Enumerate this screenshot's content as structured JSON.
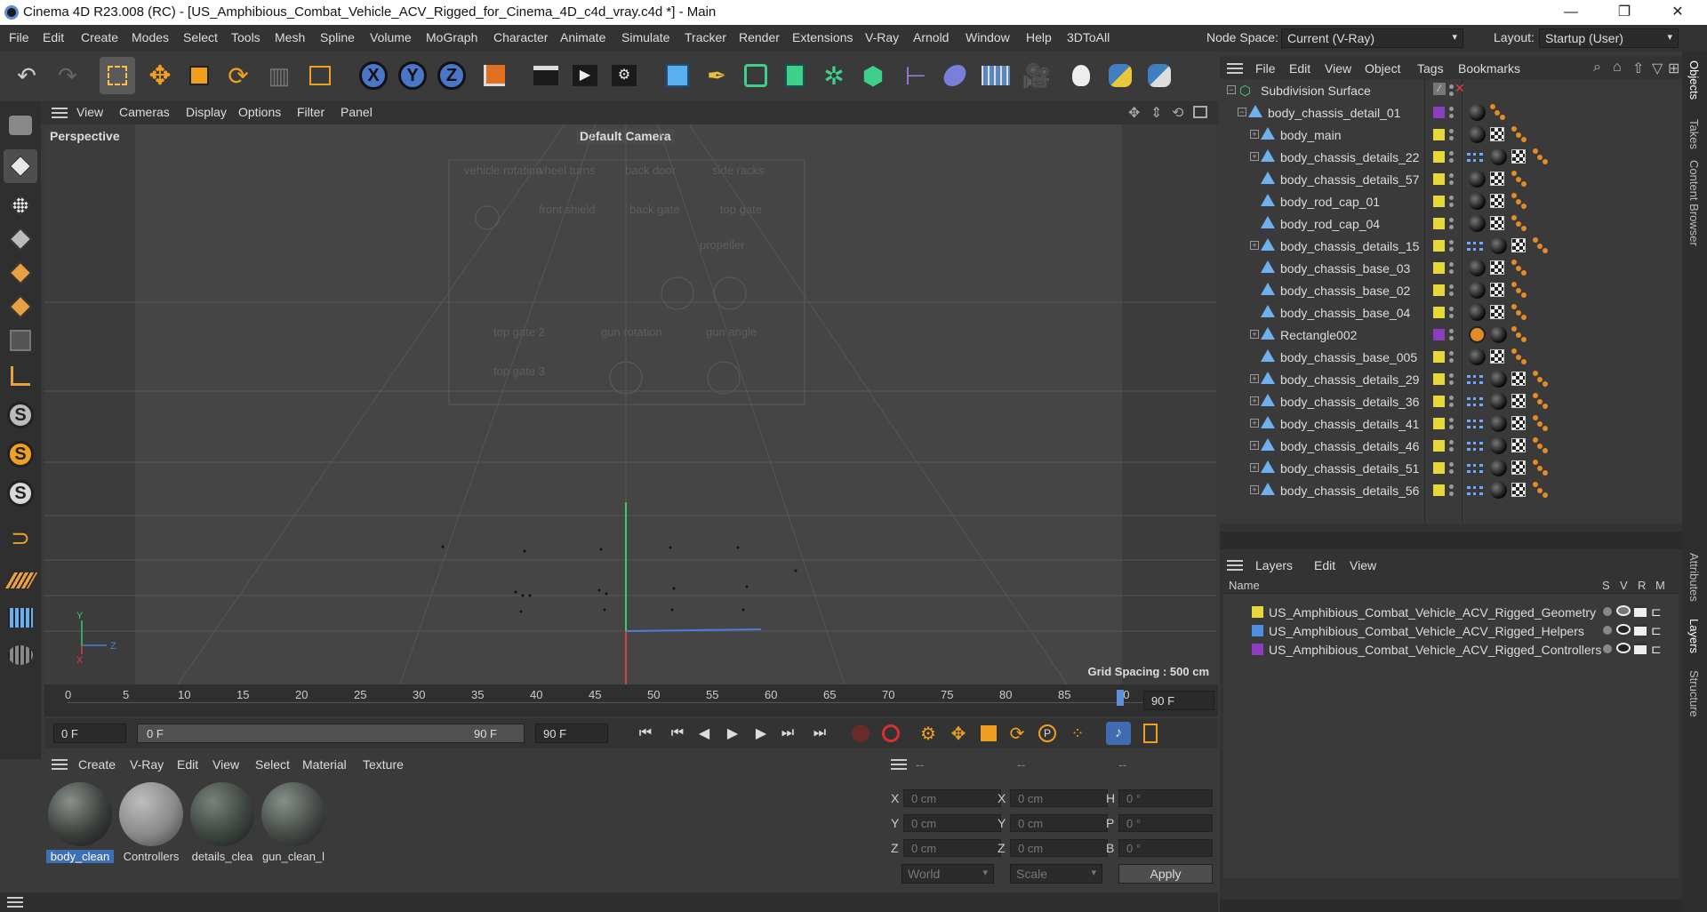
{
  "titlebar": {
    "title": "Cinema 4D R23.008 (RC) - [US_Amphibious_Combat_Vehicle_ACV_Rigged_for_Cinema_4D_c4d_vray.c4d *] - Main",
    "minimize": "—",
    "restore": "❐",
    "close": "✕"
  },
  "menubar": {
    "items": [
      "File",
      "Edit",
      "Create",
      "Modes",
      "Select",
      "Tools",
      "Mesh",
      "Spline",
      "Volume",
      "MoGraph",
      "Character",
      "Animate",
      "Simulate",
      "Tracker",
      "Render",
      "Extensions",
      "V-Ray",
      "Arnold",
      "Window",
      "Help",
      "3DToAll"
    ],
    "node_space_label": "Node Space:",
    "node_space_value": "Current (V-Ray)",
    "layout_label": "Layout:",
    "layout_value": "Startup (User)"
  },
  "viewport": {
    "menu": [
      "View",
      "Cameras",
      "Display",
      "Options",
      "Filter",
      "Panel"
    ],
    "label": "Perspective",
    "camera": "Default Camera",
    "grid_spacing": "Grid Spacing : 500 cm",
    "axis_y": "Y",
    "axis_z": "Z",
    "axis_x": "X",
    "overlay_labels": [
      "vehicle rotation",
      "wheel turns",
      "back door",
      "side racks",
      "front shield",
      "back gate",
      "top gate",
      "propeller",
      "top gate 2",
      "gun rotation",
      "gun angle",
      "top gate 3"
    ]
  },
  "timeline": {
    "ticks": [
      "0",
      "5",
      "10",
      "15",
      "20",
      "25",
      "30",
      "35",
      "40",
      "45",
      "50",
      "55",
      "60",
      "65",
      "70",
      "75",
      "80",
      "85",
      "90"
    ],
    "end_field": "90 F"
  },
  "transport": {
    "current_frame": "0 F",
    "range_start": "0 F",
    "range_end": "90 F",
    "max_frame": "90 F"
  },
  "materials": {
    "menu": [
      "Create",
      "V-Ray",
      "Edit",
      "View",
      "Select",
      "Material",
      "Texture"
    ],
    "items": [
      {
        "label": "body_clean",
        "color": "#3a3f3c"
      },
      {
        "label": "Controllers",
        "color": "#8a8a8a"
      },
      {
        "label": "details_clea",
        "color": "#3e4540"
      },
      {
        "label": "gun_clean_l",
        "color": "#454a47"
      }
    ]
  },
  "coords": {
    "headers": [
      "--",
      "--",
      "--"
    ],
    "rows": [
      {
        "a": "X",
        "av": "0 cm",
        "b": "X",
        "bv": "0 cm",
        "c": "H",
        "cv": "0 °"
      },
      {
        "a": "Y",
        "av": "0 cm",
        "b": "Y",
        "bv": "0 cm",
        "c": "P",
        "cv": "0 °"
      },
      {
        "a": "Z",
        "av": "0 cm",
        "b": "Z",
        "bv": "0 cm",
        "c": "B",
        "cv": "0 °"
      }
    ],
    "world": "World",
    "scale": "Scale",
    "apply": "Apply"
  },
  "objects": {
    "menu": [
      "File",
      "Edit",
      "View",
      "Object",
      "Tags",
      "Bookmarks"
    ],
    "root": "Subdivision Surface",
    "rows": [
      {
        "name": "body_chassis_detail_01",
        "color": "#8a3fbf",
        "indent": 0,
        "exp": true,
        "dots": false
      },
      {
        "name": "body_main",
        "color": "#e6d83a",
        "indent": 1,
        "exp": true,
        "dots": false
      },
      {
        "name": "body_chassis_details_22",
        "color": "#e6d83a",
        "indent": 1,
        "exp": true,
        "dots": true
      },
      {
        "name": "body_chassis_details_57",
        "color": "#e6d83a",
        "indent": 1,
        "exp": false,
        "dots": false
      },
      {
        "name": "body_rod_cap_01",
        "color": "#e6d83a",
        "indent": 1,
        "exp": false,
        "dots": false
      },
      {
        "name": "body_rod_cap_04",
        "color": "#e6d83a",
        "indent": 1,
        "exp": false,
        "dots": false
      },
      {
        "name": "body_chassis_details_15",
        "color": "#e6d83a",
        "indent": 1,
        "exp": true,
        "dots": true
      },
      {
        "name": "body_chassis_base_03",
        "color": "#e6d83a",
        "indent": 1,
        "exp": false,
        "dots": false
      },
      {
        "name": "body_chassis_base_02",
        "color": "#e6d83a",
        "indent": 1,
        "exp": false,
        "dots": false
      },
      {
        "name": "body_chassis_base_04",
        "color": "#e6d83a",
        "indent": 1,
        "exp": false,
        "dots": false
      },
      {
        "name": "Rectangle002",
        "color": "#8a3fbf",
        "indent": 1,
        "exp": true,
        "dots": false
      },
      {
        "name": "body_chassis_base_005",
        "color": "#e6d83a",
        "indent": 1,
        "exp": false,
        "dots": false
      },
      {
        "name": "body_chassis_details_29",
        "color": "#e6d83a",
        "indent": 1,
        "exp": true,
        "dots": true
      },
      {
        "name": "body_chassis_details_36",
        "color": "#e6d83a",
        "indent": 1,
        "exp": true,
        "dots": true
      },
      {
        "name": "body_chassis_details_41",
        "color": "#e6d83a",
        "indent": 1,
        "exp": true,
        "dots": true
      },
      {
        "name": "body_chassis_details_46",
        "color": "#e6d83a",
        "indent": 1,
        "exp": true,
        "dots": true
      },
      {
        "name": "body_chassis_details_51",
        "color": "#e6d83a",
        "indent": 1,
        "exp": true,
        "dots": true
      },
      {
        "name": "body_chassis_details_56",
        "color": "#e6d83a",
        "indent": 1,
        "exp": true,
        "dots": true
      }
    ]
  },
  "layers": {
    "menu": [
      "Layers",
      "Edit",
      "View"
    ],
    "col_name": "Name",
    "cols": [
      "S",
      "V",
      "R",
      "M"
    ],
    "rows": [
      {
        "name": "US_Amphibious_Combat_Vehicle_ACV_Rigged_Geometry",
        "color": "#e6d83a"
      },
      {
        "name": "US_Amphibious_Combat_Vehicle_ACV_Rigged_Helpers",
        "color": "#4f8fe0"
      },
      {
        "name": "US_Amphibious_Combat_Vehicle_ACV_Rigged_Controllers",
        "color": "#8a3fbf"
      }
    ]
  },
  "side_tabs": [
    "Objects",
    "Takes",
    "Content Browser",
    "Attributes",
    "Layers",
    "Structure"
  ]
}
